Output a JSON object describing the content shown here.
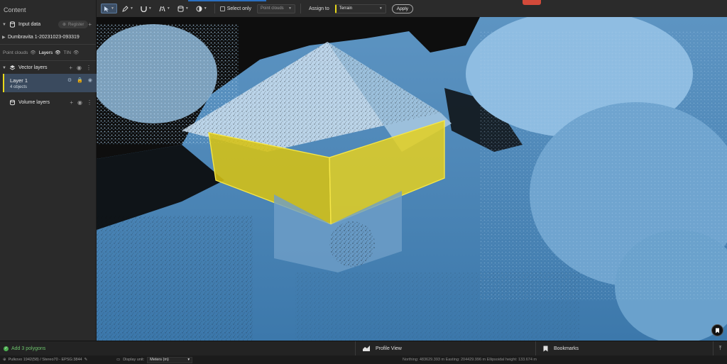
{
  "sidebar": {
    "title": "Content",
    "input_data": {
      "label": "Input data",
      "register_label": "Register"
    },
    "dataset": "Dumbravita 1-20231023-093319",
    "tabs": [
      {
        "label": "Point clouds",
        "active": false
      },
      {
        "label": "Layers",
        "active": true
      },
      {
        "label": "TIN",
        "active": false
      }
    ],
    "vector_layers": {
      "label": "Vector layers"
    },
    "layer1": {
      "name": "Layer 1",
      "count": "4 objects",
      "accent": "#e8d81a"
    },
    "volume_layers": {
      "label": "Volume layers"
    }
  },
  "toolbar": {
    "select_only_label": "Select only",
    "point_clouds_placeholder": "Point clouds",
    "assign_to_label": "Assign to",
    "assign_value": "Terrain",
    "apply_label": "Apply"
  },
  "viewport": {
    "scene": "point-cloud",
    "highlight_color": "#e8c80f"
  },
  "bottombar": {
    "status": "Add 3 polygons",
    "profile_view": "Profile View",
    "bookmarks": "Bookmarks"
  },
  "footer": {
    "crs": "Pulkovo 1942(58) / Stereo70 - EPSG:3844",
    "display_unit_label": "Display unit:",
    "display_unit_value": "Meters (m)",
    "coords": "Northing: 483629.393 m  Easting: 204429.996 m  Ellipsoidal height: 133.674 m"
  }
}
